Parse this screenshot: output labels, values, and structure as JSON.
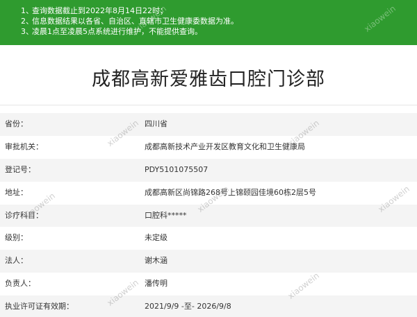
{
  "notice": {
    "items": [
      {
        "num": "1、",
        "text": "查询数据截止到2022年8月14日22时；"
      },
      {
        "num": "2、",
        "text": "信息数据结果以各省、自治区、直辖市卫生健康委数据为准。"
      },
      {
        "num": "3、",
        "text": "凌晨1点至凌晨5点系统进行维护，不能提供查询。"
      }
    ]
  },
  "clinic": {
    "title": "成都高新爱雅齿口腔门诊部"
  },
  "details": [
    {
      "label": "省份：",
      "value": "四川省"
    },
    {
      "label": "审批机关：",
      "value": "成都高新技术产业开发区教育文化和卫生健康局"
    },
    {
      "label": "登记号：",
      "value": "PDY5101075507"
    },
    {
      "label": "地址：",
      "value": "成都高新区尚锦路268号上锦颐园佳境60栋2层5号"
    },
    {
      "label": "诊疗科目：",
      "value": "口腔科*****"
    },
    {
      "label": "级别：",
      "value": "未定级"
    },
    {
      "label": "法人：",
      "value": "谢木涵"
    },
    {
      "label": "负责人：",
      "value": "潘传明"
    },
    {
      "label": "执业许可证有效期：",
      "value": "2021/9/9 -至- 2026/9/8"
    }
  ],
  "watermark": {
    "text": "xiaowein"
  }
}
